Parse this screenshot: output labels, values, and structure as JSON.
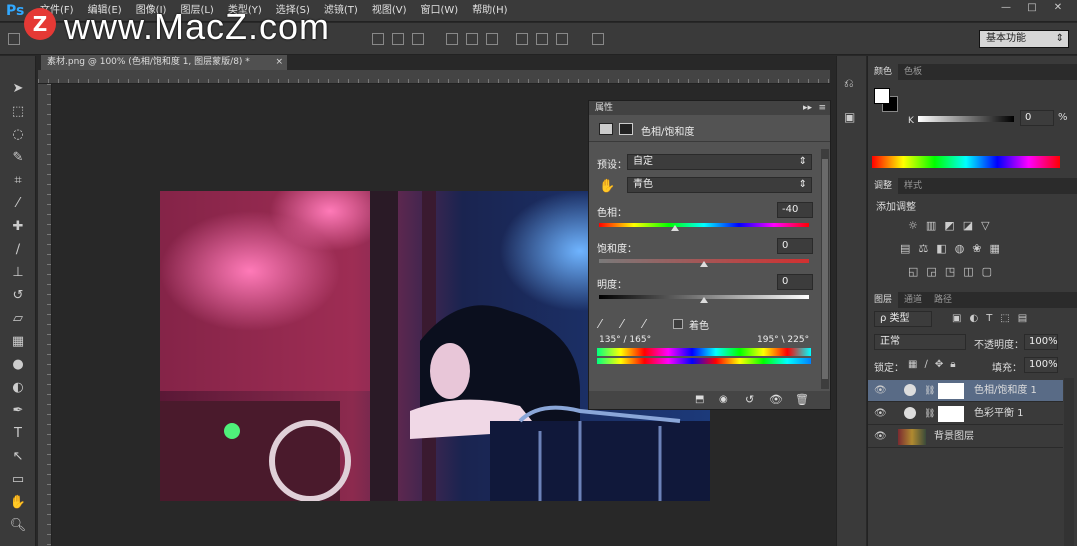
{
  "app": {
    "logo": "Ps"
  },
  "menu": [
    "文件(F)",
    "编辑(E)",
    "图像(I)",
    "图层(L)",
    "类型(Y)",
    "选择(S)",
    "滤镜(T)",
    "视图(V)",
    "窗口(W)",
    "帮助(H)"
  ],
  "window_buttons": [
    "—",
    "□",
    "✕"
  ],
  "watermark": {
    "logo": "Z",
    "text": "www.MacZ.com"
  },
  "options": {
    "workspace": "基本功能",
    "workspace_arrow": "⇕"
  },
  "document": {
    "tab_title": "素材.png @ 100% (色相/饱和度 1, 图层蒙版/8) *",
    "tab_close": "×"
  },
  "properties": {
    "header": "属性",
    "title": "色相/饱和度",
    "preset_label": "预设：",
    "preset_value": "自定",
    "channel_value": "青色",
    "hue_label": "色相：",
    "hue_value": "-40",
    "saturation_label": "饱和度：",
    "saturation_value": "0",
    "lightness_label": "明度：",
    "lightness_value": "0",
    "colorize_label": "着色",
    "range_left": "135° / 165°",
    "range_right": "195° \\ 225°",
    "hue_level": 0.36,
    "saturation_level": 0.5,
    "lightness_level": 0.5
  },
  "color_panel": {
    "tabs": [
      "颜色",
      "色板"
    ],
    "k_label": "K",
    "k_value": "0",
    "percent": "%"
  },
  "adjust_panel": {
    "tabs": [
      "调整",
      "样式"
    ],
    "add_label": "添加调整"
  },
  "layers_panel": {
    "tabs": [
      "图层",
      "通道",
      "路径"
    ],
    "filter": "ρ 类型",
    "blend_mode": "正常",
    "opacity_label": "不透明度：",
    "opacity_value": "100%",
    "lock_label": "锁定：",
    "fill_label": "填充：",
    "fill_value": "100%",
    "layers": [
      {
        "name": "色相/饱和度 1",
        "selected": true
      },
      {
        "name": "色彩平衡 1",
        "selected": false
      },
      {
        "name": "背景图层",
        "selected": false
      }
    ]
  }
}
